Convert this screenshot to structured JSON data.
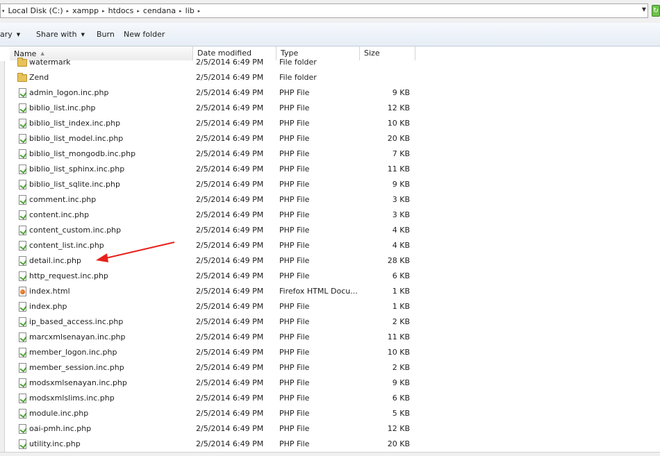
{
  "address": {
    "lead": "▾",
    "crumbs": [
      "Local Disk (C:)",
      "xampp",
      "htdocs",
      "cendana",
      "lib"
    ],
    "sep": "▸"
  },
  "toolbar": {
    "library": "ary",
    "share_with": "Share with",
    "burn": "Burn",
    "new_folder": "New folder"
  },
  "columns": {
    "name": "Name",
    "date": "Date modified",
    "type": "Type",
    "size": "Size"
  },
  "files": [
    {
      "name": "watermark",
      "date": "2/5/2014 6:49 PM",
      "type": "File folder",
      "size": "",
      "icon": "folder"
    },
    {
      "name": "Zend",
      "date": "2/5/2014 6:49 PM",
      "type": "File folder",
      "size": "",
      "icon": "folder"
    },
    {
      "name": "admin_logon.inc.php",
      "date": "2/5/2014 6:49 PM",
      "type": "PHP File",
      "size": "9 KB",
      "icon": "php"
    },
    {
      "name": "biblio_list.inc.php",
      "date": "2/5/2014 6:49 PM",
      "type": "PHP File",
      "size": "12 KB",
      "icon": "php"
    },
    {
      "name": "biblio_list_index.inc.php",
      "date": "2/5/2014 6:49 PM",
      "type": "PHP File",
      "size": "10 KB",
      "icon": "php"
    },
    {
      "name": "biblio_list_model.inc.php",
      "date": "2/5/2014 6:49 PM",
      "type": "PHP File",
      "size": "20 KB",
      "icon": "php"
    },
    {
      "name": "biblio_list_mongodb.inc.php",
      "date": "2/5/2014 6:49 PM",
      "type": "PHP File",
      "size": "7 KB",
      "icon": "php"
    },
    {
      "name": "biblio_list_sphinx.inc.php",
      "date": "2/5/2014 6:49 PM",
      "type": "PHP File",
      "size": "11 KB",
      "icon": "php"
    },
    {
      "name": "biblio_list_sqlite.inc.php",
      "date": "2/5/2014 6:49 PM",
      "type": "PHP File",
      "size": "9 KB",
      "icon": "php"
    },
    {
      "name": "comment.inc.php",
      "date": "2/5/2014 6:49 PM",
      "type": "PHP File",
      "size": "3 KB",
      "icon": "php"
    },
    {
      "name": "content.inc.php",
      "date": "2/5/2014 6:49 PM",
      "type": "PHP File",
      "size": "3 KB",
      "icon": "php"
    },
    {
      "name": "content_custom.inc.php",
      "date": "2/5/2014 6:49 PM",
      "type": "PHP File",
      "size": "4 KB",
      "icon": "php"
    },
    {
      "name": "content_list.inc.php",
      "date": "2/5/2014 6:49 PM",
      "type": "PHP File",
      "size": "4 KB",
      "icon": "php"
    },
    {
      "name": "detail.inc.php",
      "date": "2/5/2014 6:49 PM",
      "type": "PHP File",
      "size": "28 KB",
      "icon": "php"
    },
    {
      "name": "http_request.inc.php",
      "date": "2/5/2014 6:49 PM",
      "type": "PHP File",
      "size": "6 KB",
      "icon": "php"
    },
    {
      "name": "index.html",
      "date": "2/5/2014 6:49 PM",
      "type": "Firefox HTML Docu...",
      "size": "1 KB",
      "icon": "html"
    },
    {
      "name": "index.php",
      "date": "2/5/2014 6:49 PM",
      "type": "PHP File",
      "size": "1 KB",
      "icon": "php"
    },
    {
      "name": "ip_based_access.inc.php",
      "date": "2/5/2014 6:49 PM",
      "type": "PHP File",
      "size": "2 KB",
      "icon": "php"
    },
    {
      "name": "marcxmlsenayan.inc.php",
      "date": "2/5/2014 6:49 PM",
      "type": "PHP File",
      "size": "11 KB",
      "icon": "php"
    },
    {
      "name": "member_logon.inc.php",
      "date": "2/5/2014 6:49 PM",
      "type": "PHP File",
      "size": "10 KB",
      "icon": "php"
    },
    {
      "name": "member_session.inc.php",
      "date": "2/5/2014 6:49 PM",
      "type": "PHP File",
      "size": "2 KB",
      "icon": "php"
    },
    {
      "name": "modsxmlsenayan.inc.php",
      "date": "2/5/2014 6:49 PM",
      "type": "PHP File",
      "size": "9 KB",
      "icon": "php"
    },
    {
      "name": "modsxmlslims.inc.php",
      "date": "2/5/2014 6:49 PM",
      "type": "PHP File",
      "size": "6 KB",
      "icon": "php"
    },
    {
      "name": "module.inc.php",
      "date": "2/5/2014 6:49 PM",
      "type": "PHP File",
      "size": "5 KB",
      "icon": "php"
    },
    {
      "name": "oai-pmh.inc.php",
      "date": "2/5/2014 6:49 PM",
      "type": "PHP File",
      "size": "12 KB",
      "icon": "php"
    },
    {
      "name": "utility.inc.php",
      "date": "2/5/2014 6:49 PM",
      "type": "PHP File",
      "size": "20 KB",
      "icon": "php"
    }
  ],
  "annotation": {
    "color": "#e8201c"
  }
}
